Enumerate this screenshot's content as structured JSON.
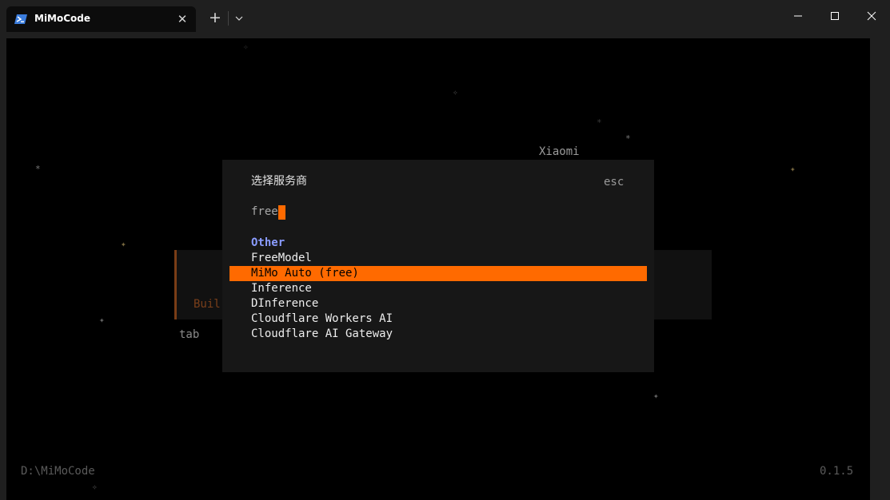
{
  "window": {
    "tab_title": "MiMoCode",
    "close_tab_glyph": "✕",
    "new_tab_glyph": "+",
    "dropdown_glyph": "⌵"
  },
  "terminal": {
    "background_text": {
      "xiaomi": "Xiaomi",
      "build": "Buil",
      "tab_hint": "tab",
      "path": "D:\\MiMoCode",
      "version": "0.1.5"
    },
    "star_glyphs": {
      "sparkle": "✦",
      "asterisk": "*",
      "hollow": "✧"
    }
  },
  "dialog": {
    "title": "选择服务商",
    "esc_label": "esc",
    "search_value": "free",
    "group_header": "Other",
    "items": [
      {
        "label": "FreeModel",
        "selected": false
      },
      {
        "label": "MiMo Auto (free)",
        "selected": true
      },
      {
        "label": "Inference",
        "selected": false
      },
      {
        "label": "DInference",
        "selected": false
      },
      {
        "label": "Cloudflare Workers AI",
        "selected": false
      },
      {
        "label": "Cloudflare AI Gateway",
        "selected": false
      }
    ]
  },
  "colors": {
    "accent": "#ff6a00",
    "group_header": "#8a9cff",
    "dialog_bg": "#171717",
    "terminal_bg": "#000000"
  }
}
